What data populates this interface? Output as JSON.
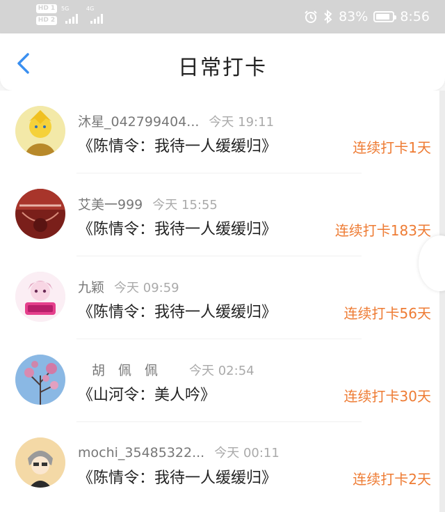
{
  "status_bar": {
    "sim1": "HD 1",
    "sim2": "HD 2",
    "sig1_label": "5G",
    "sig2_label": "4G",
    "battery": "83%",
    "time": "8:56",
    "icons": [
      "alarm-icon",
      "bluetooth-icon",
      "battery-icon"
    ]
  },
  "header": {
    "title": "日常打卡",
    "back_icon": "chevron-left-icon",
    "accent": "#3a8ff0"
  },
  "streak_color": "#ee7b33",
  "entries": [
    {
      "name": "沐星_042799404...",
      "time": "今天 19:11",
      "book": "《陈情令：我待一人缓缓归》",
      "streak": "连续打卡1天"
    },
    {
      "name": "艾美一999",
      "time": "今天 15:55",
      "book": "《陈情令：我待一人缓缓归》",
      "streak": "连续打卡183天"
    },
    {
      "name": "九颖",
      "time": "今天 09:59",
      "book": "《陈情令：我待一人缓缓归》",
      "streak": "连续打卡56天"
    },
    {
      "name": "胡　佩　佩",
      "time": "今天 02:54",
      "book": "《山河令：美人吟》",
      "streak": "连续打卡30天"
    },
    {
      "name": "mochi_35485322...",
      "time": "今天 00:11",
      "book": "《陈情令：我待一人缓缓归》",
      "streak": "连续打卡2天"
    }
  ]
}
